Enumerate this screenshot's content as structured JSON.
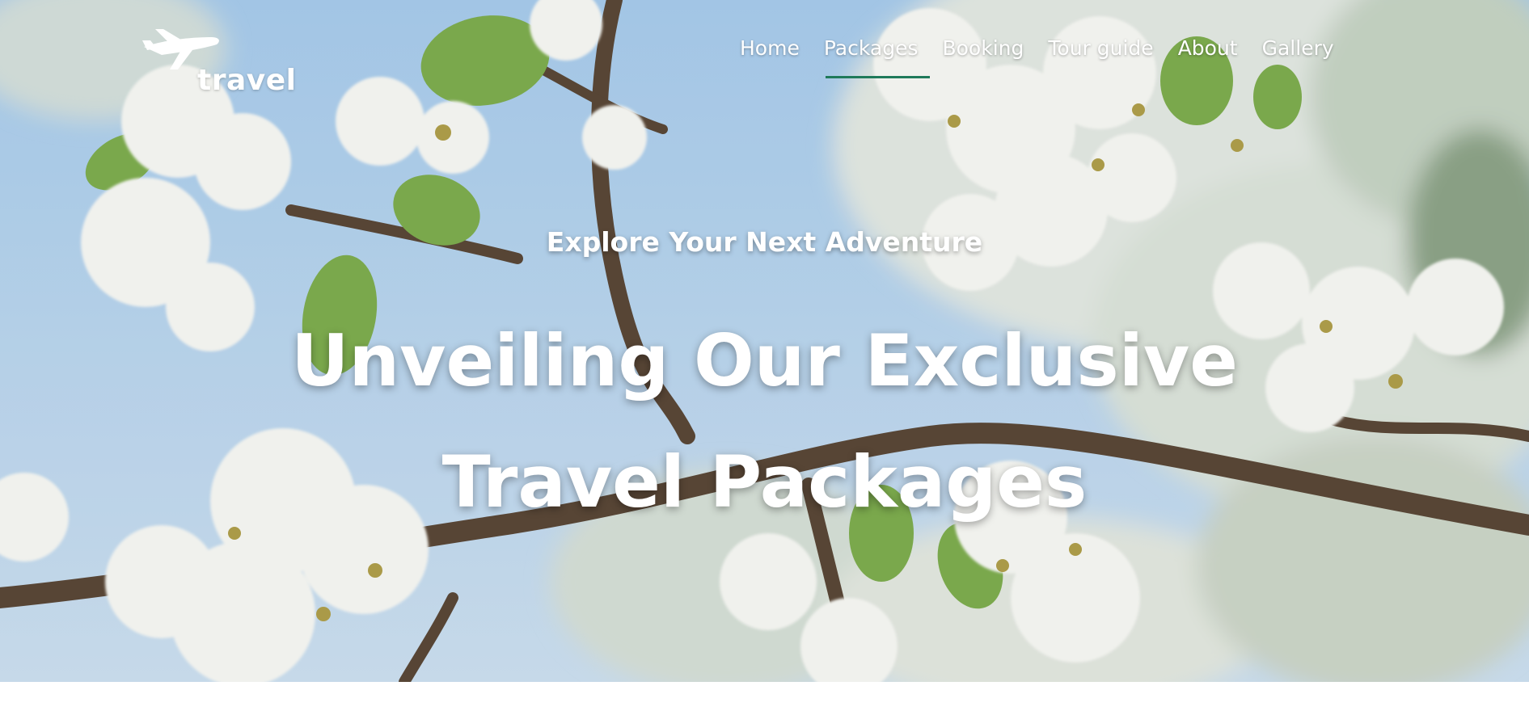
{
  "brand": {
    "logo_text": "travel",
    "logo_icon": "airplane-icon"
  },
  "nav": {
    "items": [
      {
        "label": "Home",
        "active": false
      },
      {
        "label": "Packages",
        "active": true
      },
      {
        "label": "Booking",
        "active": false
      },
      {
        "label": "Tour guide",
        "active": false
      },
      {
        "label": "About",
        "active": false
      },
      {
        "label": "Gallery",
        "active": false
      }
    ],
    "active_underline_color": "#1f7a5a"
  },
  "hero": {
    "eyebrow": "Explore Your Next Adventure",
    "headline_line1": "Unveiling Our Exclusive",
    "headline_line2": "Travel Packages",
    "background": "white blossom branches against blue sky"
  }
}
